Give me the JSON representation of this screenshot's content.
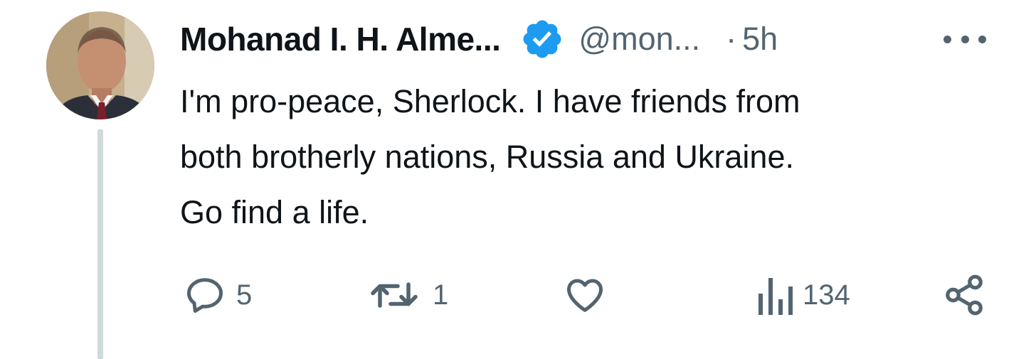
{
  "tweet": {
    "author": {
      "display_name": "Mohanad I. H. Alme...",
      "handle": "@mon...",
      "verified": true,
      "avatar_icon": "profile-photo",
      "verified_icon": "verified-badge-icon",
      "verified_color": "#1d9bf0"
    },
    "separator": "·",
    "timestamp": "5h",
    "more_icon": "more-options-icon",
    "text": "I'm pro-peace, Sherlock. I have friends from\nboth brotherly nations, Russia and Ukraine.\nGo find a life.",
    "actions": {
      "reply": {
        "icon": "reply-icon",
        "count": "5"
      },
      "retweet": {
        "icon": "retweet-icon",
        "count": "1"
      },
      "like": {
        "icon": "heart-icon",
        "count": ""
      },
      "views": {
        "icon": "views-icon",
        "count": "134"
      },
      "share": {
        "icon": "share-icon"
      }
    }
  },
  "colors": {
    "primary_text": "#0f1419",
    "secondary_text": "#536471",
    "thread_line": "#cfd9de"
  }
}
